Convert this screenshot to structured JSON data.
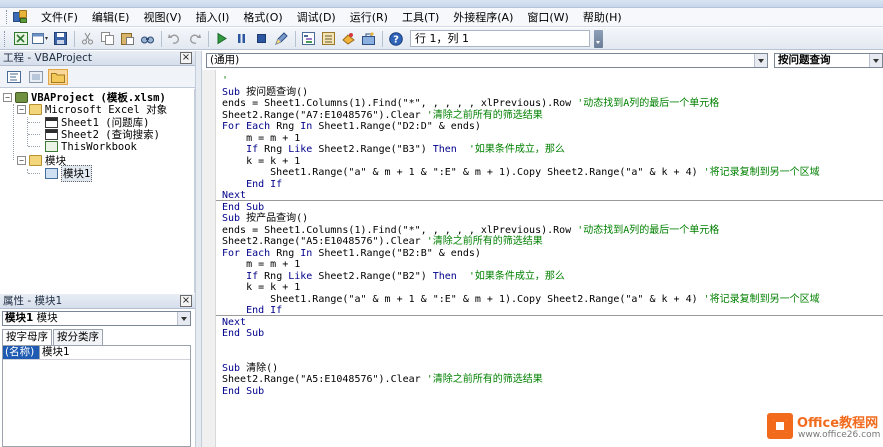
{
  "menu": {
    "items": [
      "文件(F)",
      "编辑(E)",
      "视图(V)",
      "插入(I)",
      "格式(O)",
      "调试(D)",
      "运行(R)",
      "工具(T)",
      "外接程序(A)",
      "窗口(W)",
      "帮助(H)"
    ]
  },
  "toolbar": {
    "position": "行 1，列 1",
    "icons": [
      "excel-icon",
      "insert-module-icon",
      "save-icon",
      "cut-icon",
      "copy-icon",
      "paste-icon",
      "find-icon",
      "undo-icon",
      "redo-icon",
      "run-icon",
      "break-icon",
      "reset-icon",
      "design-mode-icon",
      "project-explorer-icon",
      "properties-icon",
      "object-browser-icon",
      "toolbox-icon",
      "help-icon"
    ]
  },
  "project_pane": {
    "title": "工程 - VBAProject",
    "close": "×",
    "tree": {
      "root": "VBAProject (模板.xlsm)",
      "excel_objects": "Microsoft Excel 对象",
      "sheet1": "Sheet1 (问题库)",
      "sheet2": "Sheet2 (查询搜索)",
      "workbook": "ThisWorkbook",
      "modules": "模块",
      "module1": "模块1"
    }
  },
  "properties_pane": {
    "title": "属性 - 模块1",
    "close": "×",
    "object_name": "模块1",
    "object_type": "模块",
    "tabs": [
      "按字母序",
      "按分类序"
    ],
    "rows": [
      {
        "key": "(名称)",
        "value": "模块1"
      }
    ]
  },
  "code_window": {
    "object_combo": "(通用)",
    "proc_combo": "按问题查询",
    "lines": [
      [
        {
          "t": "'",
          "c": "cm"
        }
      ],
      [
        {
          "t": "Sub ",
          "c": "kw"
        },
        {
          "t": "按问题查询()",
          "c": ""
        }
      ],
      [
        {
          "t": "ends = Sheet1.Columns(1).Find(\"*\", , , , , xlPrevious).Row ",
          "c": ""
        },
        {
          "t": "'动态找到A列的最后一个单元格",
          "c": "cm"
        }
      ],
      [
        {
          "t": "Sheet2.Range(\"A7:E1048576\").Clear ",
          "c": ""
        },
        {
          "t": "'清除之前所有的筛选结果",
          "c": "cm"
        }
      ],
      [
        {
          "t": "For Each ",
          "c": "kw"
        },
        {
          "t": "Rng ",
          "c": ""
        },
        {
          "t": "In ",
          "c": "kw"
        },
        {
          "t": "Sheet1.Range(\"D2:D\" & ends)",
          "c": ""
        }
      ],
      [
        {
          "t": "    m = m + 1",
          "c": ""
        }
      ],
      [
        {
          "t": "    ",
          "c": ""
        },
        {
          "t": "If ",
          "c": "kw"
        },
        {
          "t": "Rng ",
          "c": ""
        },
        {
          "t": "Like ",
          "c": "kw"
        },
        {
          "t": "Sheet2.Range(\"B3\") ",
          "c": ""
        },
        {
          "t": "Then",
          "c": "kw"
        },
        {
          "t": "  ",
          "c": ""
        },
        {
          "t": "'如果条件成立，那么",
          "c": "cm"
        }
      ],
      [
        {
          "t": "    k = k + 1",
          "c": ""
        }
      ],
      [
        {
          "t": "        Sheet1.Range(\"a\" & m + 1 & \":E\" & m + 1).Copy Sheet2.Range(\"a\" & k + 4) ",
          "c": ""
        },
        {
          "t": "'将记录复制到另一个区域",
          "c": "cm"
        }
      ],
      [
        {
          "t": "    End If",
          "c": "kw"
        }
      ],
      [
        {
          "t": "Next",
          "c": "kw"
        }
      ],
      [
        {
          "t": "End Sub",
          "c": "kw"
        }
      ],
      [
        {
          "t": "Sub ",
          "c": "kw"
        },
        {
          "t": "按产品查询()",
          "c": ""
        }
      ],
      [
        {
          "t": "ends = Sheet1.Columns(1).Find(\"*\", , , , , xlPrevious).Row ",
          "c": ""
        },
        {
          "t": "'动态找到A列的最后一个单元格",
          "c": "cm"
        }
      ],
      [
        {
          "t": "Sheet2.Range(\"A5:E1048576\").Clear ",
          "c": ""
        },
        {
          "t": "'清除之前所有的筛选结果",
          "c": "cm"
        }
      ],
      [
        {
          "t": "For Each ",
          "c": "kw"
        },
        {
          "t": "Rng ",
          "c": ""
        },
        {
          "t": "In ",
          "c": "kw"
        },
        {
          "t": "Sheet1.Range(\"B2:B\" & ends)",
          "c": ""
        }
      ],
      [
        {
          "t": "    m = m + 1",
          "c": ""
        }
      ],
      [
        {
          "t": "    ",
          "c": ""
        },
        {
          "t": "If ",
          "c": "kw"
        },
        {
          "t": "Rng ",
          "c": ""
        },
        {
          "t": "Like ",
          "c": "kw"
        },
        {
          "t": "Sheet2.Range(\"B2\") ",
          "c": ""
        },
        {
          "t": "Then",
          "c": "kw"
        },
        {
          "t": "  ",
          "c": ""
        },
        {
          "t": "'如果条件成立，那么",
          "c": "cm"
        }
      ],
      [
        {
          "t": "    k = k + 1",
          "c": ""
        }
      ],
      [
        {
          "t": "        Sheet1.Range(\"a\" & m + 1 & \":E\" & m + 1).Copy Sheet2.Range(\"a\" & k + 4) ",
          "c": ""
        },
        {
          "t": "'将记录复制到另一个区域",
          "c": "cm"
        }
      ],
      [
        {
          "t": "    End If",
          "c": "kw"
        }
      ],
      [
        {
          "t": "Next",
          "c": "kw"
        }
      ],
      [
        {
          "t": "End Sub",
          "c": "kw"
        }
      ],
      [],
      [],
      [
        {
          "t": "Sub ",
          "c": "kw"
        },
        {
          "t": "清除()",
          "c": ""
        }
      ],
      [
        {
          "t": "Sheet2.Range(\"A5:E1048576\").Clear ",
          "c": ""
        },
        {
          "t": "'清除之前所有的筛选结果",
          "c": "cm"
        }
      ],
      [
        {
          "t": "End Sub",
          "c": "kw"
        }
      ]
    ]
  },
  "watermark": {
    "title": "Office教程网",
    "url": "www.office26.com"
  },
  "colors": {
    "keyword": "#00008b",
    "comment": "#008000",
    "selection": "#1f5ab3",
    "watermark": "#f26b1d"
  }
}
